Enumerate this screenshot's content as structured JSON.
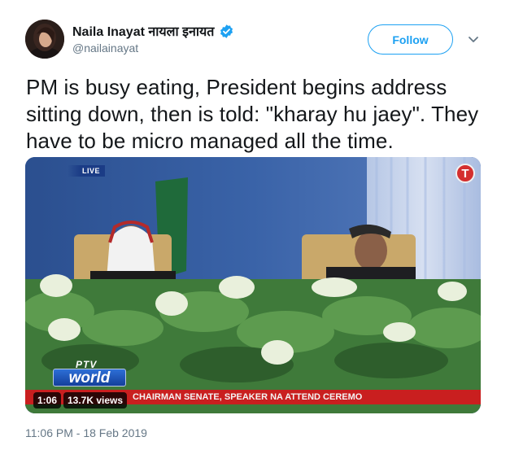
{
  "author": {
    "display_name": "Naila Inayat नायला इनायत",
    "handle": "@nailainayat",
    "verified": true
  },
  "actions": {
    "follow_label": "Follow"
  },
  "tweet": {
    "text": "PM is busy eating, President begins address sitting down, then is told: \"kharay hu jaey\". They have to be micro managed all the time."
  },
  "video": {
    "live_label": "LIVE",
    "channel_badge": "T",
    "ptv_label": "PTV",
    "world_label": "world",
    "ticker_text": "CHAIRMAN SENATE, SPEAKER NA ATTEND CEREMO",
    "duration": "1:06",
    "views": "13.7K views"
  },
  "timestamp": "11:06 PM - 18 Feb 2019",
  "colors": {
    "accent": "#1da1f2",
    "text": "#14171a",
    "secondary": "#657786",
    "ticker_red": "#c91f1f"
  },
  "icons": {
    "verified": "verified-badge-icon",
    "caret": "chevron-down-icon"
  }
}
